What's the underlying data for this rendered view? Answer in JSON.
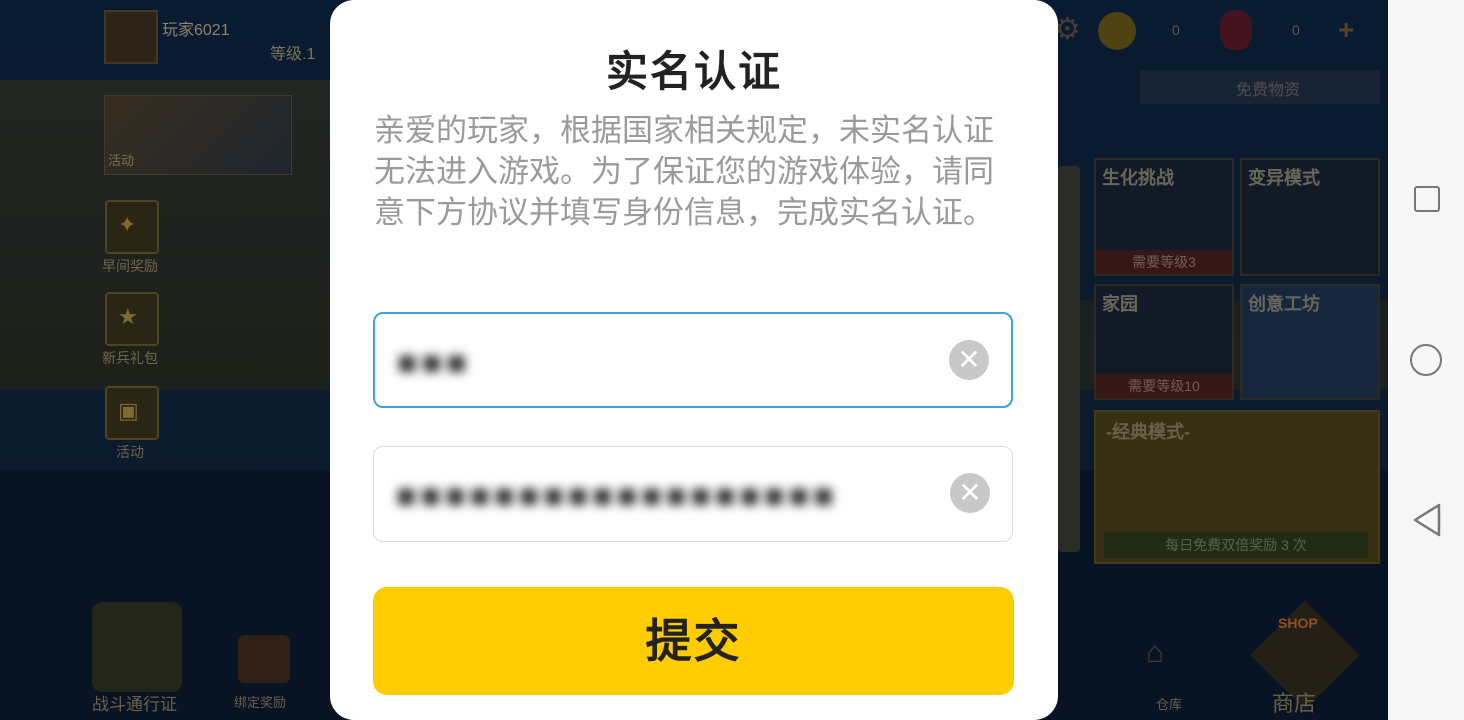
{
  "background": {
    "player": {
      "name": "玩家6021",
      "level": "等级.1"
    },
    "side_buttons": [
      {
        "label": "活动"
      },
      {
        "label": "早间奖励"
      },
      {
        "label": "新兵礼包"
      },
      {
        "label": "活动"
      }
    ],
    "currency": {
      "gold": "0",
      "gems": "0"
    },
    "free_supplies": "免费物资",
    "modes": [
      {
        "title": "生化挑战",
        "requirement": "需要等级3"
      },
      {
        "title": "变异模式",
        "requirement": ""
      },
      {
        "title": "家园",
        "requirement": "需要等级10"
      },
      {
        "title": "创意工坊",
        "requirement": ""
      }
    ],
    "classic": {
      "title": "-经典模式-",
      "footer": "每日免费双倍奖励 3 次"
    },
    "bottom": {
      "battle_pass": "战斗通行证",
      "bind_reward": "绑定奖励",
      "warehouse": "仓库",
      "shop": "商店",
      "shop_tag": "SHOP"
    }
  },
  "modal": {
    "title": "实名认证",
    "description": "亲爱的玩家，根据国家相关规定，未实名认证无法进入游戏。为了保证您的游戏体验，请同意下方协议并填写身份信息，完成实名认证。",
    "name_field": {
      "value": "■■■",
      "clear_icon": "close-icon"
    },
    "id_field": {
      "value": "■■■■■■■■■■■■■■■■■■",
      "clear_icon": "close-icon"
    },
    "submit_label": "提交"
  },
  "navbar": {
    "icons": [
      "recent-apps-icon",
      "home-icon",
      "back-icon"
    ]
  },
  "colors": {
    "accent_yellow": "#ffcc00",
    "focus_blue": "#3aa6dd",
    "desc_gray": "#9a9a9a"
  }
}
